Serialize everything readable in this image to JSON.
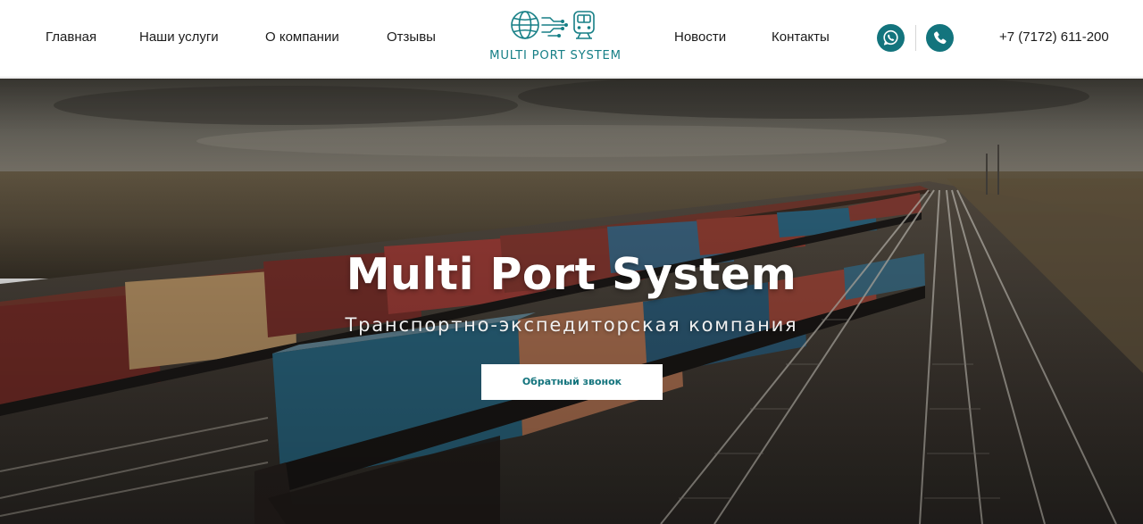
{
  "nav": {
    "left": [
      "Главная",
      "Наши услуги",
      "О компании",
      "Отзывы"
    ],
    "right": [
      "Новости",
      "Контакты"
    ]
  },
  "logo": {
    "text": "MULTI PORT SYSTEM"
  },
  "contacts": {
    "phone": "+7 (7172) 611-200",
    "whatsapp_icon": "whatsapp-icon",
    "phone_icon": "phone-icon"
  },
  "hero": {
    "title": "Multi Port System",
    "subtitle": "Транспортно-экспедиторская компания",
    "cta_label": "Обратный звонок",
    "background": "freight-train-containers-photo"
  },
  "colors": {
    "brand": "#13747d",
    "logo_text": "#167f86",
    "nav_text": "#1b1b1b",
    "cta_background": "#ffffff"
  }
}
